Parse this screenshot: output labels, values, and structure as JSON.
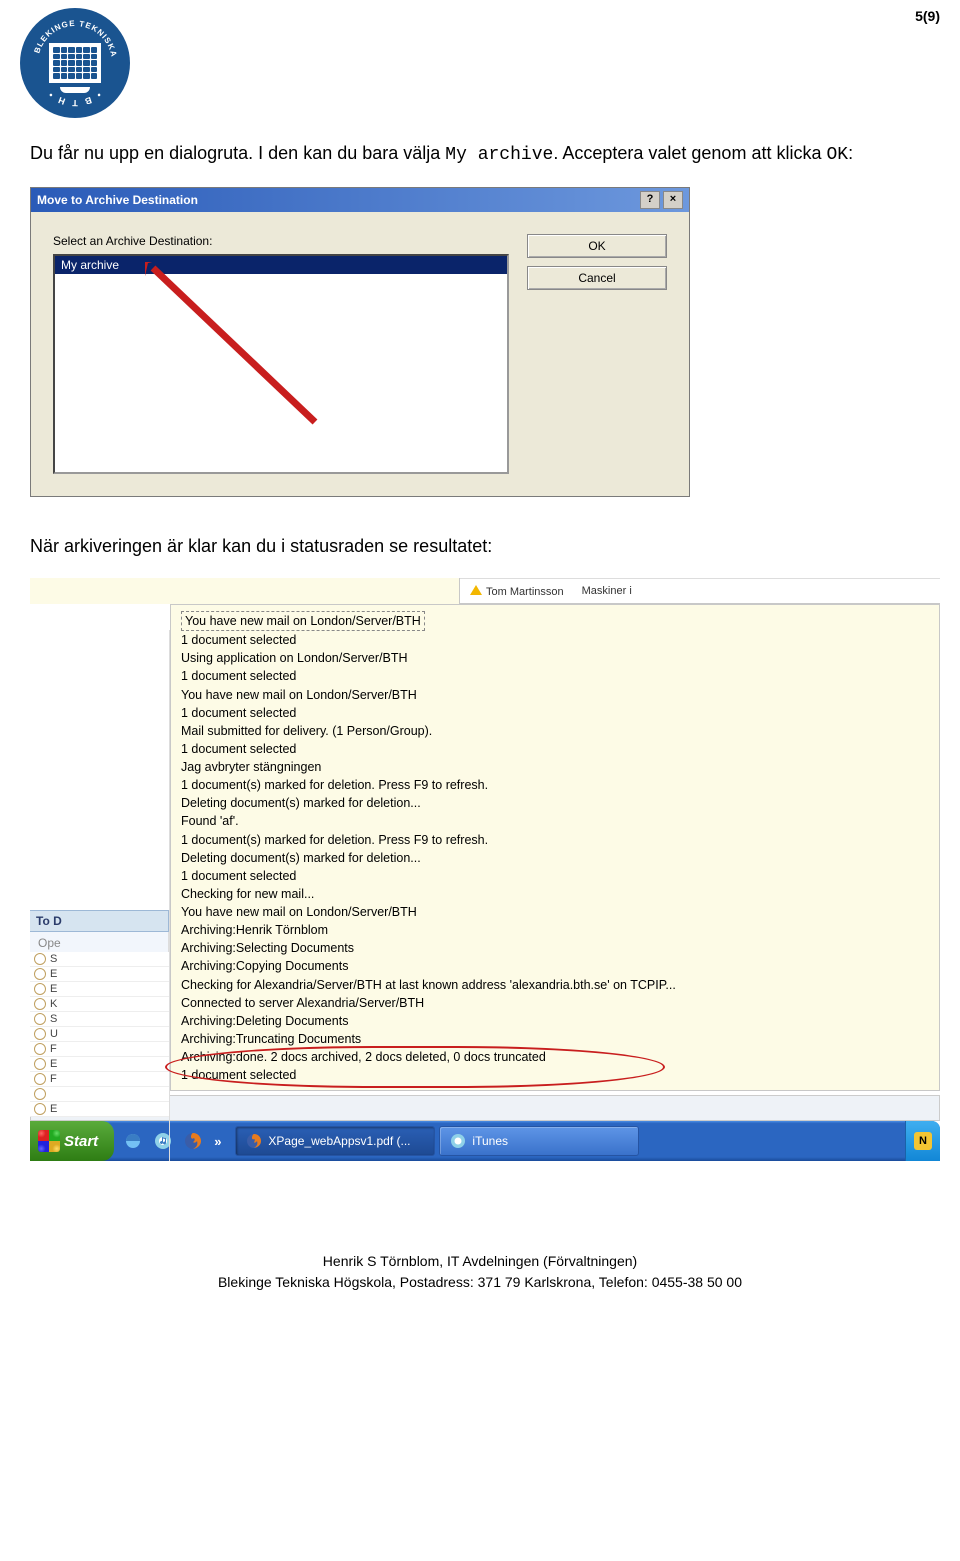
{
  "page_number": "5(9)",
  "paragraph1_a": "Du får nu upp en dialogruta. I den kan du bara välja ",
  "paragraph1_code1": "My archive",
  "paragraph1_b": ". Acceptera valet genom att klicka ",
  "paragraph1_code2": "OK",
  "paragraph1_c": ":",
  "dialog": {
    "title": "Move to Archive Destination",
    "label": "Select an Archive Destination:",
    "selected_item": "My archive",
    "ok": "OK",
    "cancel": "Cancel"
  },
  "paragraph2": "När arkiveringen är klar kan du i statusraden se resultatet:",
  "result_top": {
    "name": "Tom Martinsson",
    "col2": "Maskiner i"
  },
  "log_lines": [
    "You have new mail on London/Server/BTH",
    "1 document selected",
    "Using application on London/Server/BTH",
    "1 document selected",
    "You have new mail on London/Server/BTH",
    "1 document selected",
    "Mail submitted for delivery.  (1 Person/Group).",
    "1 document selected",
    "Jag avbryter stängningen",
    "1 document(s) marked for deletion.  Press F9 to refresh.",
    "Deleting document(s) marked for deletion...",
    "  Found 'af'.",
    "1 document(s) marked for deletion.  Press F9 to refresh.",
    "Deleting document(s) marked for deletion...",
    "1 document selected",
    "Checking for new mail...",
    "You have new mail on London/Server/BTH",
    "Archiving:Henrik Törnblom",
    "Archiving:Selecting Documents",
    "Archiving:Copying Documents",
    "Checking for Alexandria/Server/BTH at last known address 'alexandria.bth.se' on TCPIP...",
    "Connected to server Alexandria/Server/BTH",
    "Archiving:Deleting Documents",
    "Archiving:Truncating Documents",
    "Archiving:done. 2 docs archived, 2 docs deleted, 0 docs truncated",
    "1 document selected"
  ],
  "left_panel": {
    "todo": "To D",
    "ope": "Ope"
  },
  "statusbar_text": "1 document selected",
  "taskbar": {
    "start": "Start",
    "task1": "XPage_webAppsv1.pdf (...",
    "task2": "iTunes"
  },
  "footer_line1": "Henrik S Törnblom, IT Avdelningen (Förvaltningen)",
  "footer_line2": "Blekinge Tekniska Högskola, Postadress: 371 79 Karlskrona, Telefon: 0455-38 50 00"
}
